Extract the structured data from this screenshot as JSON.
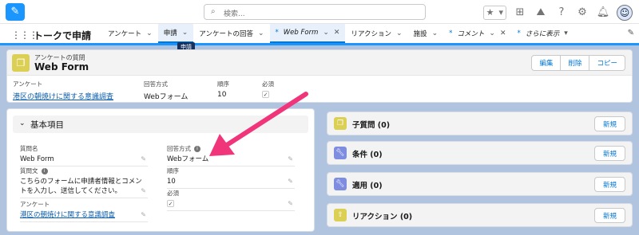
{
  "search": {
    "placeholder": "検索..."
  },
  "app": {
    "name": "トークで申請"
  },
  "tooltip": "申請",
  "tabs": [
    {
      "label": "アンケート",
      "suffix": "⌄"
    },
    {
      "label": "申請",
      "suffix": "⌄"
    },
    {
      "label": "アンケートの回答",
      "suffix": "⌄"
    },
    {
      "label": "Web Form",
      "suffix": "⌄"
    },
    {
      "label": "リアクション",
      "suffix": "⌄"
    },
    {
      "label": "施設",
      "suffix": "⌄"
    },
    {
      "label": "コメント",
      "suffix": "⌄"
    },
    {
      "label": "さらに表示",
      "suffix": "▾"
    }
  ],
  "record": {
    "type": "アンケートの質問",
    "name": "Web Form",
    "buttons": {
      "edit": "編集",
      "delete": "削除",
      "copy": "コピー"
    }
  },
  "highlights": {
    "survey_label": "アンケート",
    "survey_value": "港区の朝焼けに関する意識調査",
    "answer_label": "回答方式",
    "answer_value": "Webフォーム",
    "order_label": "順序",
    "order_value": "10",
    "required_label": "必須"
  },
  "detail": {
    "section_title": "基本項目",
    "question_name_label": "質問名",
    "question_name_value": "Web Form",
    "question_text_label": "質問文",
    "question_text_value": "こちらのフォームに申請者情報とコメントを入力し、送信してください。",
    "survey_label": "アンケート",
    "survey_value": "港区の朝焼けに関する意識調査",
    "answer_label": "回答方式",
    "answer_value": "Webフォーム",
    "order_label": "順序",
    "order_value": "10",
    "required_label": "必須"
  },
  "related": [
    {
      "title": "子質問 (0)",
      "button": "新規",
      "color": "#dbcf54"
    },
    {
      "title": "条件 (0)",
      "button": "新規",
      "color": "#7f8de1"
    },
    {
      "title": "適用 (0)",
      "button": "新規",
      "color": "#7f8de1"
    },
    {
      "title": "リアクション (0)",
      "button": "新規",
      "color": "#dbcf54"
    }
  ],
  "colors": {
    "accent": "#0176d3",
    "arrow": "#f0357a"
  }
}
